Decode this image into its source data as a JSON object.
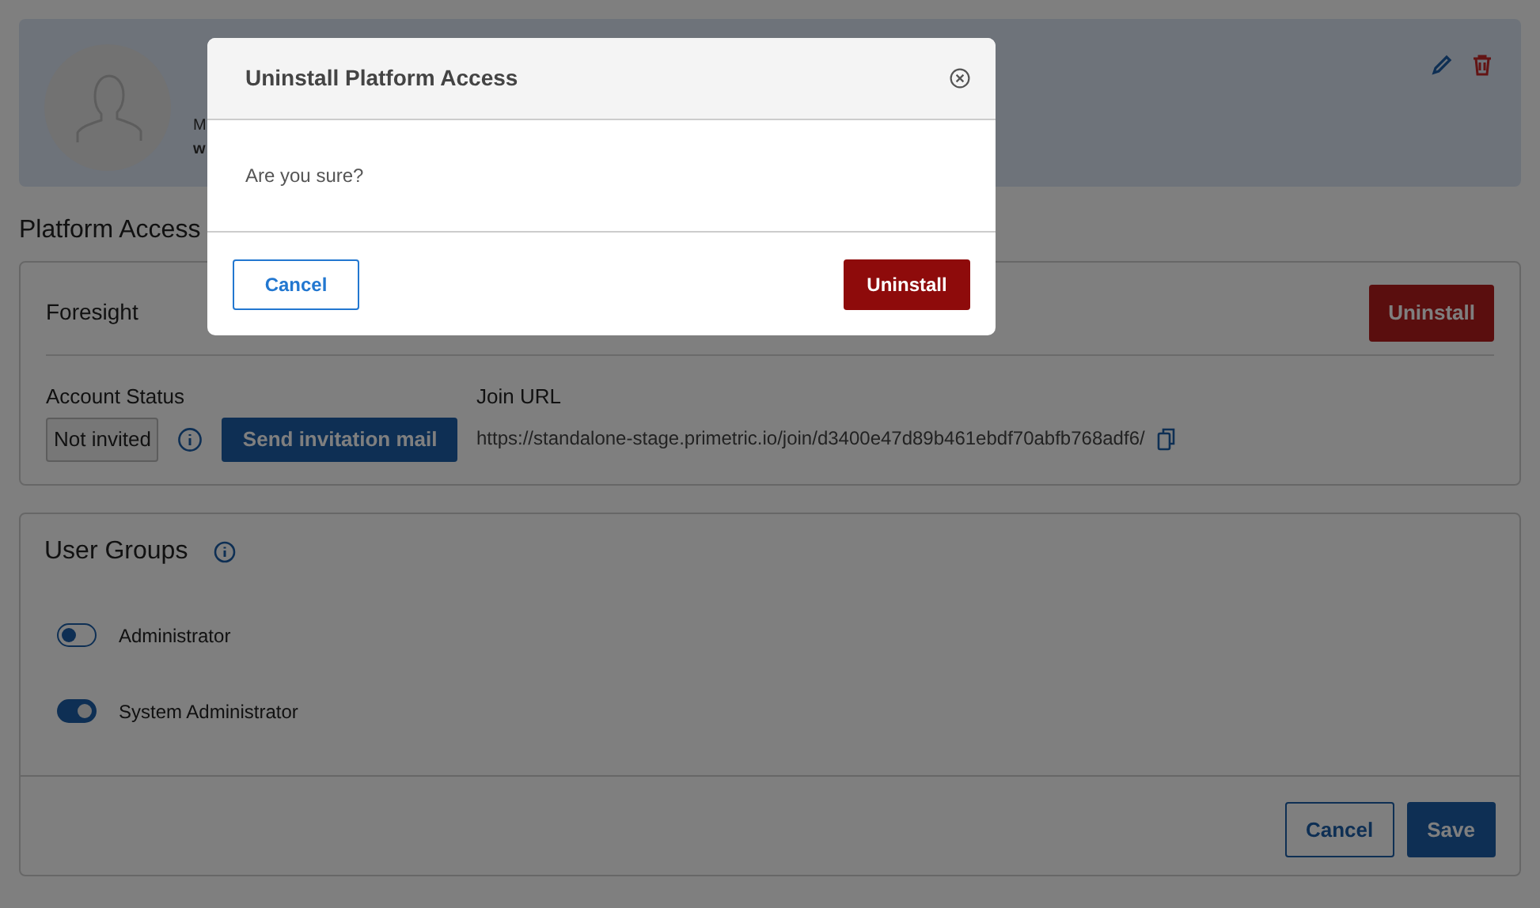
{
  "profile": {
    "line_1_visible": "M",
    "line_2_visible": "w"
  },
  "section_title": "Platform Access",
  "platforms": [
    {
      "name": "Foresight",
      "uninstall_label": "Uninstall",
      "status_label": "Account Status",
      "status": "Not invited",
      "invite_label": "Send invitation mail",
      "url_label": "Join URL",
      "url": "https://standalone-stage.primetric.io/join/d3400e47d89b461ebdf70abfb768adf6/"
    }
  ],
  "user_groups": {
    "title": "User Groups",
    "items": [
      {
        "label": "Administrator",
        "on": false
      },
      {
        "label": "System Administrator",
        "on": true
      }
    ],
    "buttons": [
      "Cancel",
      "Save"
    ]
  },
  "modal": {
    "title": "Uninstall Platform Access",
    "body": "Are you sure?",
    "cancel": "Cancel",
    "confirm": "Uninstall"
  }
}
